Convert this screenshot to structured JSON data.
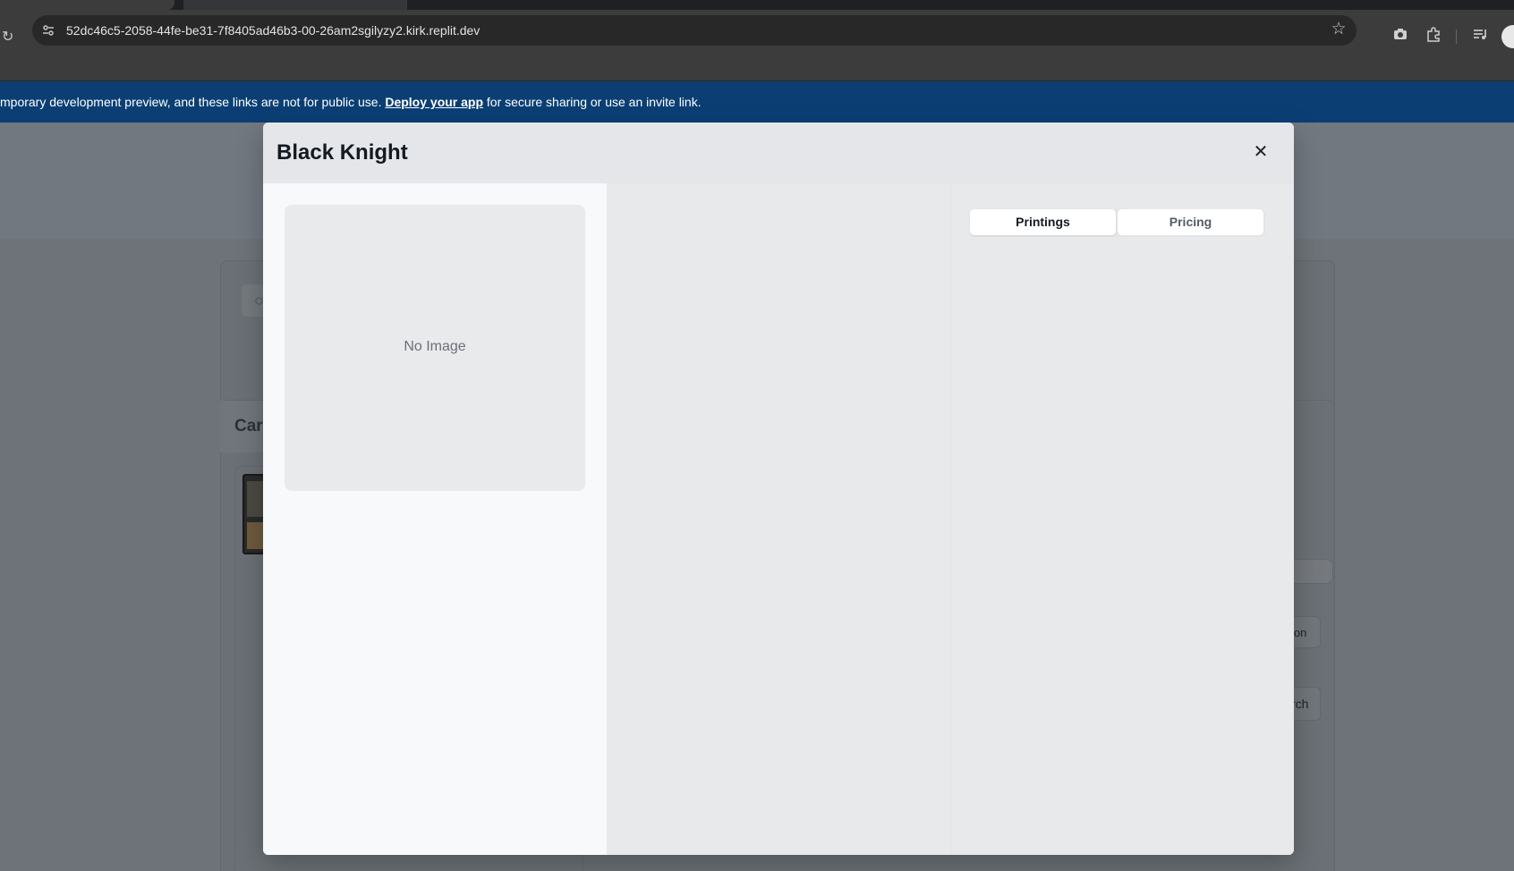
{
  "browser": {
    "url": "52dc46c5-2058-44fe-be31-7f8405ad46b3-00-26am2sgilyzy2.kirk.replit.dev",
    "icons": {
      "reload": "reload-icon",
      "site_info": "tune-icon",
      "bookmark": "star-icon",
      "screenshot": "camera-icon",
      "extensions": "puzzle-icon",
      "media": "media-queue-icon"
    }
  },
  "banner": {
    "text_before": "mporary development preview, and these links are not for public use. ",
    "link": "Deploy your app",
    "text_after": " for secure sharing or use an invite link."
  },
  "background": {
    "card_section_title": "Car",
    "button_1": "ion",
    "button_2": "rch"
  },
  "modal": {
    "title": "Black Knight",
    "close_symbol": "✕",
    "image_placeholder": "No Image",
    "tabs": [
      {
        "label": "Printings",
        "active": true
      },
      {
        "label": "Pricing",
        "active": false
      }
    ]
  },
  "colors": {
    "banner": "#0b3f74",
    "modal_bg": "#e8e9eb",
    "left_panel": "#f7f9fb"
  }
}
